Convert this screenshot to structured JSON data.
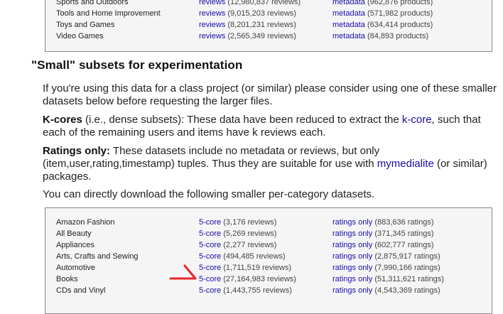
{
  "top_table": {
    "rows": [
      {
        "category": "Sports and Outdoors",
        "reviews_link": "reviews",
        "reviews_count": "(12,980,837 reviews)",
        "metadata_link": "metadata",
        "metadata_count": "(962,876 products)"
      },
      {
        "category": "Tools and Home Improvement",
        "reviews_link": "reviews",
        "reviews_count": "(9,015,203 reviews)",
        "metadata_link": "metadata",
        "metadata_count": "(571,982 products)"
      },
      {
        "category": "Toys and Games",
        "reviews_link": "reviews",
        "reviews_count": "(8,201,231 reviews)",
        "metadata_link": "metadata",
        "metadata_count": "(634,414 products)"
      },
      {
        "category": "Video Games",
        "reviews_link": "reviews",
        "reviews_count": "(2,565,349 reviews)",
        "metadata_link": "metadata",
        "metadata_count": "(84,893 products)"
      }
    ]
  },
  "section": {
    "heading": "\"Small\" subsets for experimentation",
    "intro": "If you're using this data for a class project (or similar) please consider using one of these smaller datasets below before requesting the larger files.",
    "kcores": {
      "label": "K-cores",
      "text_before": " (i.e., dense subsets): These data have been reduced to extract the ",
      "link": "k-core",
      "text_after": ", such that each of the remaining users and items have k reviews each."
    },
    "ratings": {
      "label": "Ratings only:",
      "text_before": " These datasets include no metadata or reviews, but only (item,user,rating,timestamp) tuples. Thus they are suitable for use with ",
      "link": "mymedialite",
      "text_after": " (or similar) packages."
    },
    "download": "You can directly download the following smaller per-category datasets."
  },
  "small_table": {
    "rows": [
      {
        "category": "Amazon Fashion",
        "core_link": "5-core",
        "core_count": "(3,176 reviews)",
        "ratings_link": "ratings only",
        "ratings_count": "(883,636 ratings)"
      },
      {
        "category": "All Beauty",
        "core_link": "5-core",
        "core_count": "(5,269 reviews)",
        "ratings_link": "ratings only",
        "ratings_count": "(371,345 ratings)"
      },
      {
        "category": "Appliances",
        "core_link": "5-core",
        "core_count": "(2,277 reviews)",
        "ratings_link": "ratings only",
        "ratings_count": "(602,777 ratings)"
      },
      {
        "category": "Arts, Crafts and Sewing",
        "core_link": "5-core",
        "core_count": "(494,485 reviews)",
        "ratings_link": "ratings only",
        "ratings_count": "(2,875,917 ratings)"
      },
      {
        "category": "Automotive",
        "core_link": "5-core",
        "core_count": "(1,711,519 reviews)",
        "ratings_link": "ratings only",
        "ratings_count": "(7,990,166 ratings)"
      },
      {
        "category": "Books",
        "core_link": "5-core",
        "core_count": "(27,164,983 reviews)",
        "ratings_link": "ratings only",
        "ratings_count": "(51,311,621 ratings)"
      },
      {
        "category": "CDs and Vinyl",
        "core_link": "5-core",
        "core_count": "(1,443,755 reviews)",
        "ratings_link": "ratings only",
        "ratings_count": "(4,543,369 ratings)"
      }
    ]
  },
  "annotation": {
    "icon": "red-arrow-icon",
    "color": "#e8262b"
  },
  "colors": {
    "link": "#1a0dab",
    "table_bg": "#f5f5f5",
    "border": "#888888"
  }
}
